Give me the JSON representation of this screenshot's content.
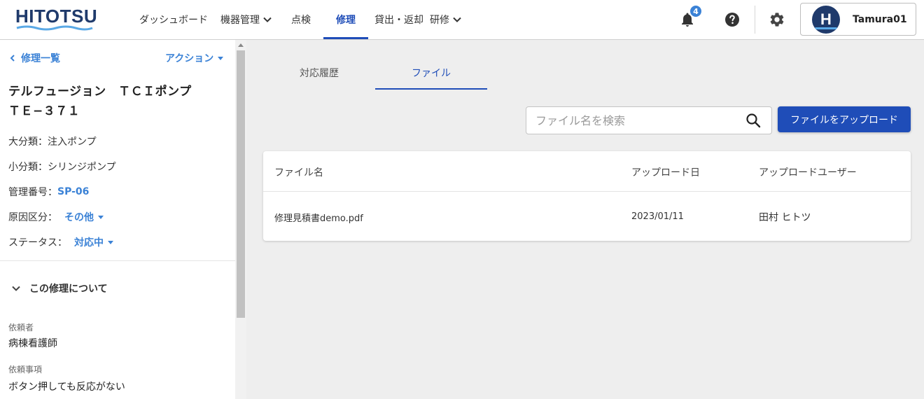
{
  "header": {
    "logo_text": "HITOTSU",
    "nav": [
      {
        "label": "ダッシュボード"
      },
      {
        "label": "機器管理"
      },
      {
        "label": "点検"
      },
      {
        "label": "修理"
      },
      {
        "label": "貸出・返却"
      },
      {
        "label": "研修"
      }
    ],
    "notification_count": "4",
    "user": {
      "initial": "H",
      "name": "Tamura01"
    }
  },
  "sidebar": {
    "back_label": "修理一覧",
    "action_label": "アクション",
    "title_line1": "テルフュージョン　ＴＣＩポンプ",
    "title_line2": "ＴＥ−３７１",
    "major_label": "大分類：",
    "major_value": "注入ポンプ",
    "minor_label": "小分類：",
    "minor_value": "シリンジポンプ",
    "mgmt_label": "管理番号：",
    "mgmt_value": "SP-06",
    "cause_label": "原因区分：",
    "cause_value": "その他",
    "status_label": "ステータス：",
    "status_value": "対応中",
    "section_title": "この修理について",
    "requester_label": "依頼者",
    "requester_value": "病棟看護師",
    "request_label": "依頼事項",
    "request_value": "ボタン押しても反応がない"
  },
  "main": {
    "tabs": [
      {
        "label": "対応履歴"
      },
      {
        "label": "ファイル"
      }
    ],
    "search_placeholder": "ファイル名を検索",
    "upload_label": "ファイルをアップロード",
    "table": {
      "columns": [
        "ファイル名",
        "アップロード日",
        "アップロードユーザー"
      ],
      "rows": [
        {
          "filename": "修理見積書demo.pdf",
          "date": "2023/01/11",
          "user": "田村 ヒトツ"
        }
      ]
    }
  },
  "colors": {
    "primary": "#1f4db8",
    "link": "#3b82d6",
    "logo": "#1f3a6b"
  }
}
